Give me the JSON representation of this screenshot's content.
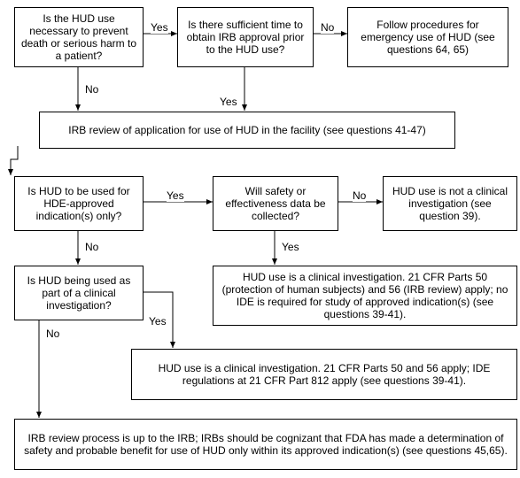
{
  "nodes": {
    "q_prevent": "Is the HUD use necessary to prevent death or serious harm to a patient?",
    "q_time": "Is there sufficient time to obtain IRB approval prior to the HUD use?",
    "emergency": "Follow procedures for emergency use of HUD (see questions 64, 65)",
    "irb_review": "IRB review of application for use of HUD in the facility (see questions 41-47)",
    "q_hde": "Is HUD to be used for HDE-approved indication(s) only?",
    "q_safety": "Will safety or effectiveness data be collected?",
    "not_clinical": "HUD use is not a clinical investigation (see question 39).",
    "q_clinical": "Is HUD being used as part of a clinical investigation?",
    "clinical_a": "HUD use is a clinical investigation. 21 CFR Parts 50 (protection of human subjects) and 56 (IRB review) apply; no IDE is required for study of approved indication(s) (see questions 39-41).",
    "clinical_b": "HUD use is a clinical investigation. 21 CFR Parts 50 and 56 apply; IDE regulations at 21 CFR Part 812 apply (see questions 39-41).",
    "irb_process": "IRB review process is up to the IRB; IRBs should be cognizant that FDA has made a determination of safety and probable benefit for use of HUD only within its approved indication(s) (see questions 45,65)."
  },
  "labels": {
    "yes": "Yes",
    "no": "No"
  },
  "chart_data": {
    "type": "flowchart",
    "edges": [
      {
        "from": "q_prevent",
        "to": "q_time",
        "label": "Yes"
      },
      {
        "from": "q_prevent",
        "to": "irb_review",
        "label": "No"
      },
      {
        "from": "q_time",
        "to": "emergency",
        "label": "No"
      },
      {
        "from": "q_time",
        "to": "irb_review",
        "label": "Yes"
      },
      {
        "from": "irb_review",
        "to": "q_hde",
        "label": ""
      },
      {
        "from": "q_hde",
        "to": "q_safety",
        "label": "Yes"
      },
      {
        "from": "q_hde",
        "to": "q_clinical",
        "label": "No"
      },
      {
        "from": "q_safety",
        "to": "not_clinical",
        "label": "No"
      },
      {
        "from": "q_safety",
        "to": "clinical_a",
        "label": "Yes"
      },
      {
        "from": "q_clinical",
        "to": "clinical_b",
        "label": "Yes"
      },
      {
        "from": "q_clinical",
        "to": "irb_process",
        "label": "No"
      }
    ]
  }
}
